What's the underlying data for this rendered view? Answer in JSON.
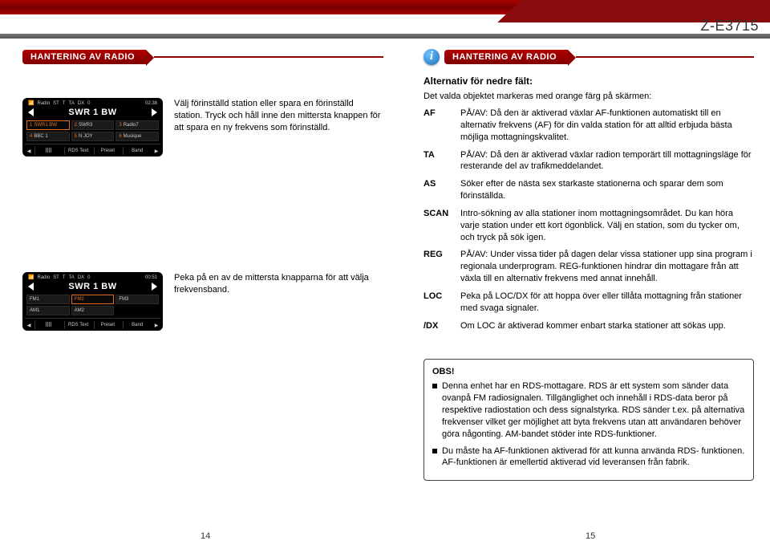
{
  "model": "Z-E3715",
  "left": {
    "section_title": "HANTERING AV RADIO",
    "shot1": {
      "status": {
        "label": "Radio",
        "st": "ST",
        "ta": "TA",
        "dx": "DX",
        "zero": "0",
        "time": "02:38"
      },
      "title": "SWR 1 BW",
      "cells": [
        "SWR1 BW",
        "SWR3",
        "Radio7",
        "BBC 1",
        "N JOY",
        "Musique"
      ],
      "cell_nums": [
        "1",
        "2",
        "3",
        "4",
        "5",
        "6"
      ],
      "selected": 0,
      "foot": [
        "RDS Text",
        "Preset",
        "Band"
      ]
    },
    "desc1": "Välj förinställd station eller spara en förinställd station. Tryck och håll inne den mittersta knappen för att spara en ny frekvens som förinställd.",
    "shot2": {
      "status": {
        "label": "Radio",
        "st": "ST",
        "ta": "TA",
        "dx": "DX",
        "zero": "0",
        "time": "00:51"
      },
      "title": "SWR 1 BW",
      "cells": [
        "FM1",
        "FM2",
        "FM3",
        "AM1",
        "AM2"
      ],
      "selected": 1,
      "foot": [
        "RDS Text",
        "Preset",
        "Band"
      ]
    },
    "desc2": "Peka på en av de mittersta knapparna för att välja frekvensband.",
    "page_num": "14"
  },
  "right": {
    "section_title": "HANTERING AV RADIO",
    "sub_heading": "Alternativ för nedre fält:",
    "intro": "Det valda objektet markeras med orange färg på skärmen:",
    "defs": [
      {
        "term": "AF",
        "def": "PÅ/AV: Då den är aktiverad växlar AF-funktionen automatiskt till en alternativ frekvens (AF) för din valda station för att alltid erbjuda bästa möjliga mottagningskvalitet."
      },
      {
        "term": "TA",
        "def": "PÅ/AV: Då den är aktiverad växlar radion temporärt till mottagningsläge för resterande del av trafikmeddelandet."
      },
      {
        "term": "AS",
        "def": "Söker efter de nästa sex starkaste stationerna och sparar dem som förinställda."
      },
      {
        "term": "SCAN",
        "def": "Intro-sökning av alla stationer inom mottagningsområdet. Du kan höra varje station under ett kort ögonblick. Välj en station, som du tycker om, och tryck på sök igen."
      },
      {
        "term": "REG",
        "def": "PÅ/AV: Under vissa tider på dagen delar vissa stationer upp sina program i regionala underprogram. REG-funktionen hindrar din mottagare från att växla till en alternativ frekvens med annat innehåll."
      },
      {
        "term": "LOC",
        "def": "Peka på LOC/DX för att hoppa över eller tillåta mottagning från stationer med svaga signaler."
      },
      {
        "term": "/DX",
        "def": "Om LOC är aktiverad kommer enbart starka stationer att sökas upp."
      }
    ],
    "obs": {
      "title": "OBS!",
      "items": [
        "Denna enhet har en RDS-mottagare. RDS är ett system som sänder data ovanpå FM radiosignalen. Tillgänglighet och innehåll i RDS-data beror på respektive radiostation och dess signalstyrka. RDS sänder t.ex. på alternativa frekvenser vilket ger möjlighet att byta frekvens utan att användaren behöver göra någonting. AM-bandet stöder inte RDS-funktioner.",
        "Du måste ha AF-funktionen aktiverad för att kunna använda RDS- funktionen. AF-funktionen är emellertid aktiverad vid leveransen från fabrik."
      ]
    },
    "page_num": "15"
  }
}
